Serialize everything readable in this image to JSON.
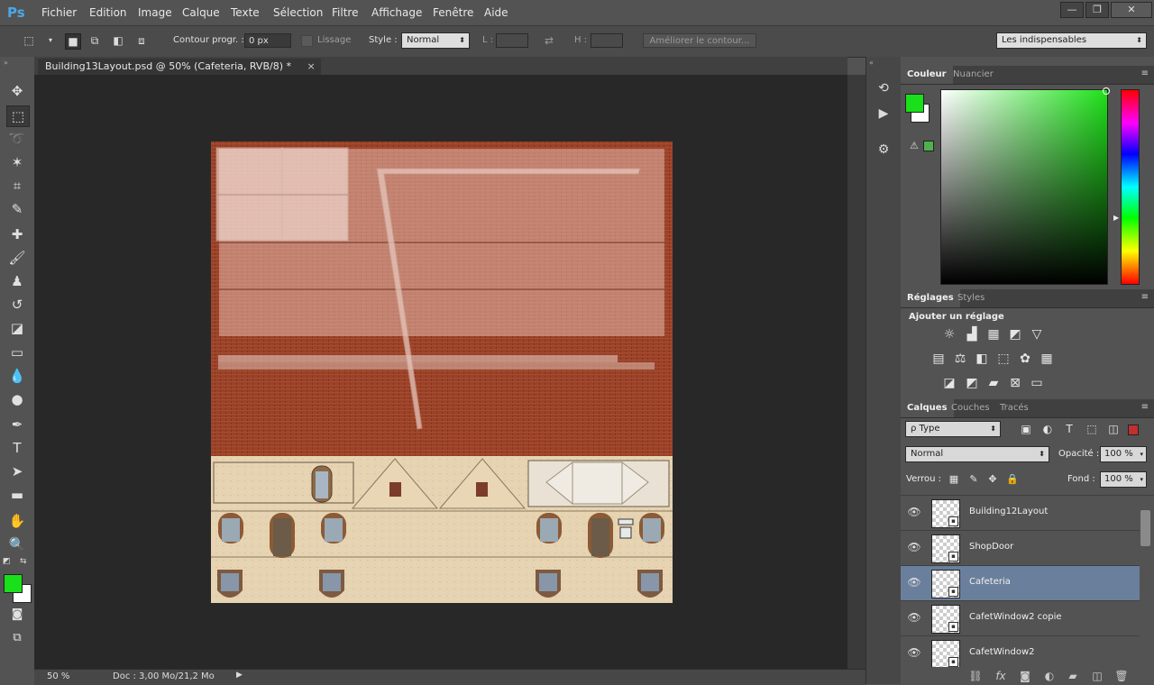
{
  "app": {
    "logo": "Ps"
  },
  "menu": [
    "Fichier",
    "Edition",
    "Image",
    "Calque",
    "Texte",
    "Sélection",
    "Filtre",
    "Affichage",
    "Fenêtre",
    "Aide"
  ],
  "window_buttons": [
    "—",
    "❐",
    "✕"
  ],
  "options": {
    "feather_label": "Contour progr. :",
    "feather_value": "0 px",
    "antialias_label": "Lissage",
    "style_label": "Style :",
    "style_value": "Normal",
    "width_label": "L :",
    "height_label": "H :",
    "refine_label": "Améliorer le contour...",
    "workspace": "Les indispensables"
  },
  "document": {
    "tab_title": "Building13Layout.psd @ 50% (Cafeteria, RVB/8) *",
    "tab_close": "×",
    "zoom": "50 %",
    "doc_info": "Doc : 3,00 Mo/21,2 Mo"
  },
  "color_panel": {
    "tabs": [
      "Couleur",
      "Nuancier"
    ],
    "foreground": "#19e01a",
    "background": "#ffffff",
    "hue_color": "#1fe11a"
  },
  "adjustments_panel": {
    "tabs": [
      "Réglages",
      "Styles"
    ],
    "title": "Ajouter un réglage"
  },
  "layers_panel": {
    "tabs": [
      "Calques",
      "Couches",
      "Tracés"
    ],
    "filter_value": "ρ Type",
    "blend_mode": "Normal",
    "opacity_label": "Opacité :",
    "opacity_value": "100 %",
    "lock_label": "Verrou :",
    "fill_label": "Fond :",
    "fill_value": "100 %",
    "layers": [
      {
        "name": "Building12Layout",
        "selected": false
      },
      {
        "name": "ShopDoor",
        "selected": false
      },
      {
        "name": "Cafeteria",
        "selected": true
      },
      {
        "name": "CafetWindow2 copie",
        "selected": false
      },
      {
        "name": "CafetWindow2",
        "selected": false
      }
    ]
  }
}
